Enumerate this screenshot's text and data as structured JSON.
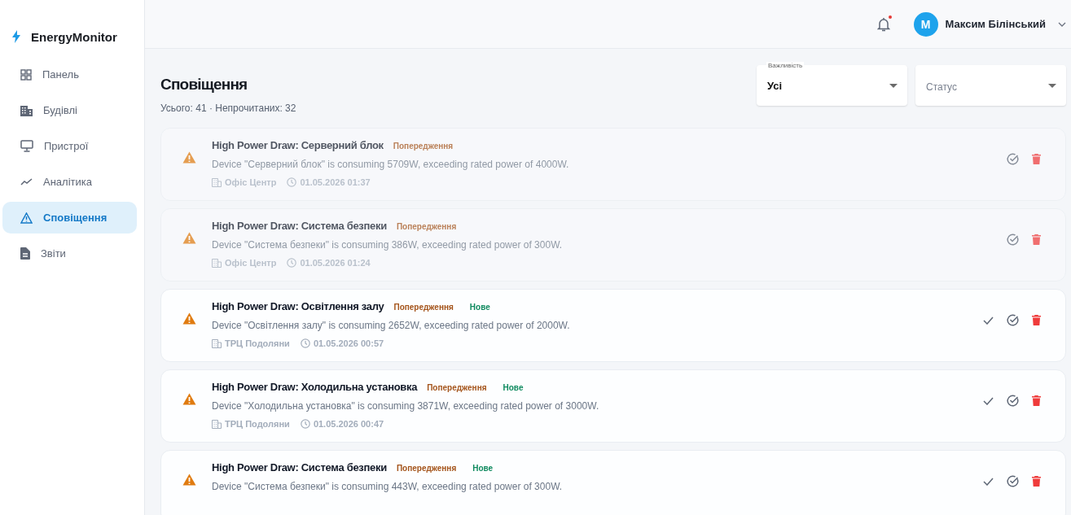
{
  "brand": {
    "name": "EnergyMonitor"
  },
  "sidebar": {
    "items": [
      {
        "label": "Панель",
        "selected": false
      },
      {
        "label": "Будівлі",
        "selected": false
      },
      {
        "label": "Пристрої",
        "selected": false
      },
      {
        "label": "Аналітика",
        "selected": false
      },
      {
        "label": "Сповіщення",
        "selected": true
      },
      {
        "label": "Звіти",
        "selected": false
      }
    ]
  },
  "topbar": {
    "has_new_notifications": true,
    "user": {
      "initial": "М",
      "name": "Максим Білінський"
    }
  },
  "page": {
    "title": "Сповіщення",
    "summary": "Усього: 41 · Непрочитаних: 32"
  },
  "filters": [
    {
      "label": "Важливість",
      "value": "Усі"
    },
    {
      "placeholder": "Статус"
    }
  ],
  "notifications": [
    {
      "title": "High Power Draw: Серверний блок",
      "severity": "Попередження",
      "read": true,
      "message": "Device \"Серверний блок\" is consuming 5709W, exceeding rated power of 4000W.",
      "building": "Офіс Центр",
      "time": "01.05.2026 01:37"
    },
    {
      "title": "High Power Draw: Система безпеки",
      "severity": "Попередження",
      "read": true,
      "message": "Device \"Система безпеки\" is consuming 386W, exceeding rated power of 300W.",
      "building": "Офіс Центр",
      "time": "01.05.2026 01:24"
    },
    {
      "title": "High Power Draw: Освітлення залу",
      "severity": "Попередження",
      "read": false,
      "new_label": "Нове",
      "message": "Device \"Освітлення залу\" is consuming 2652W, exceeding rated power of 2000W.",
      "building": "ТРЦ Подоляни",
      "time": "01.05.2026 00:57"
    },
    {
      "title": "High Power Draw: Холодильна установка",
      "severity": "Попередження",
      "read": false,
      "new_label": "Нове",
      "message": "Device \"Холодильна установка\" is consuming 3871W, exceeding rated power of 3000W.",
      "building": "ТРЦ Подоляни",
      "time": "01.05.2026 00:47"
    },
    {
      "title": "High Power Draw: Система безпеки",
      "severity": "Попередження",
      "read": false,
      "new_label": "Нове",
      "message": "Device \"Система безпеки\" is consuming 443W, exceeding rated power of 300W."
    }
  ]
}
